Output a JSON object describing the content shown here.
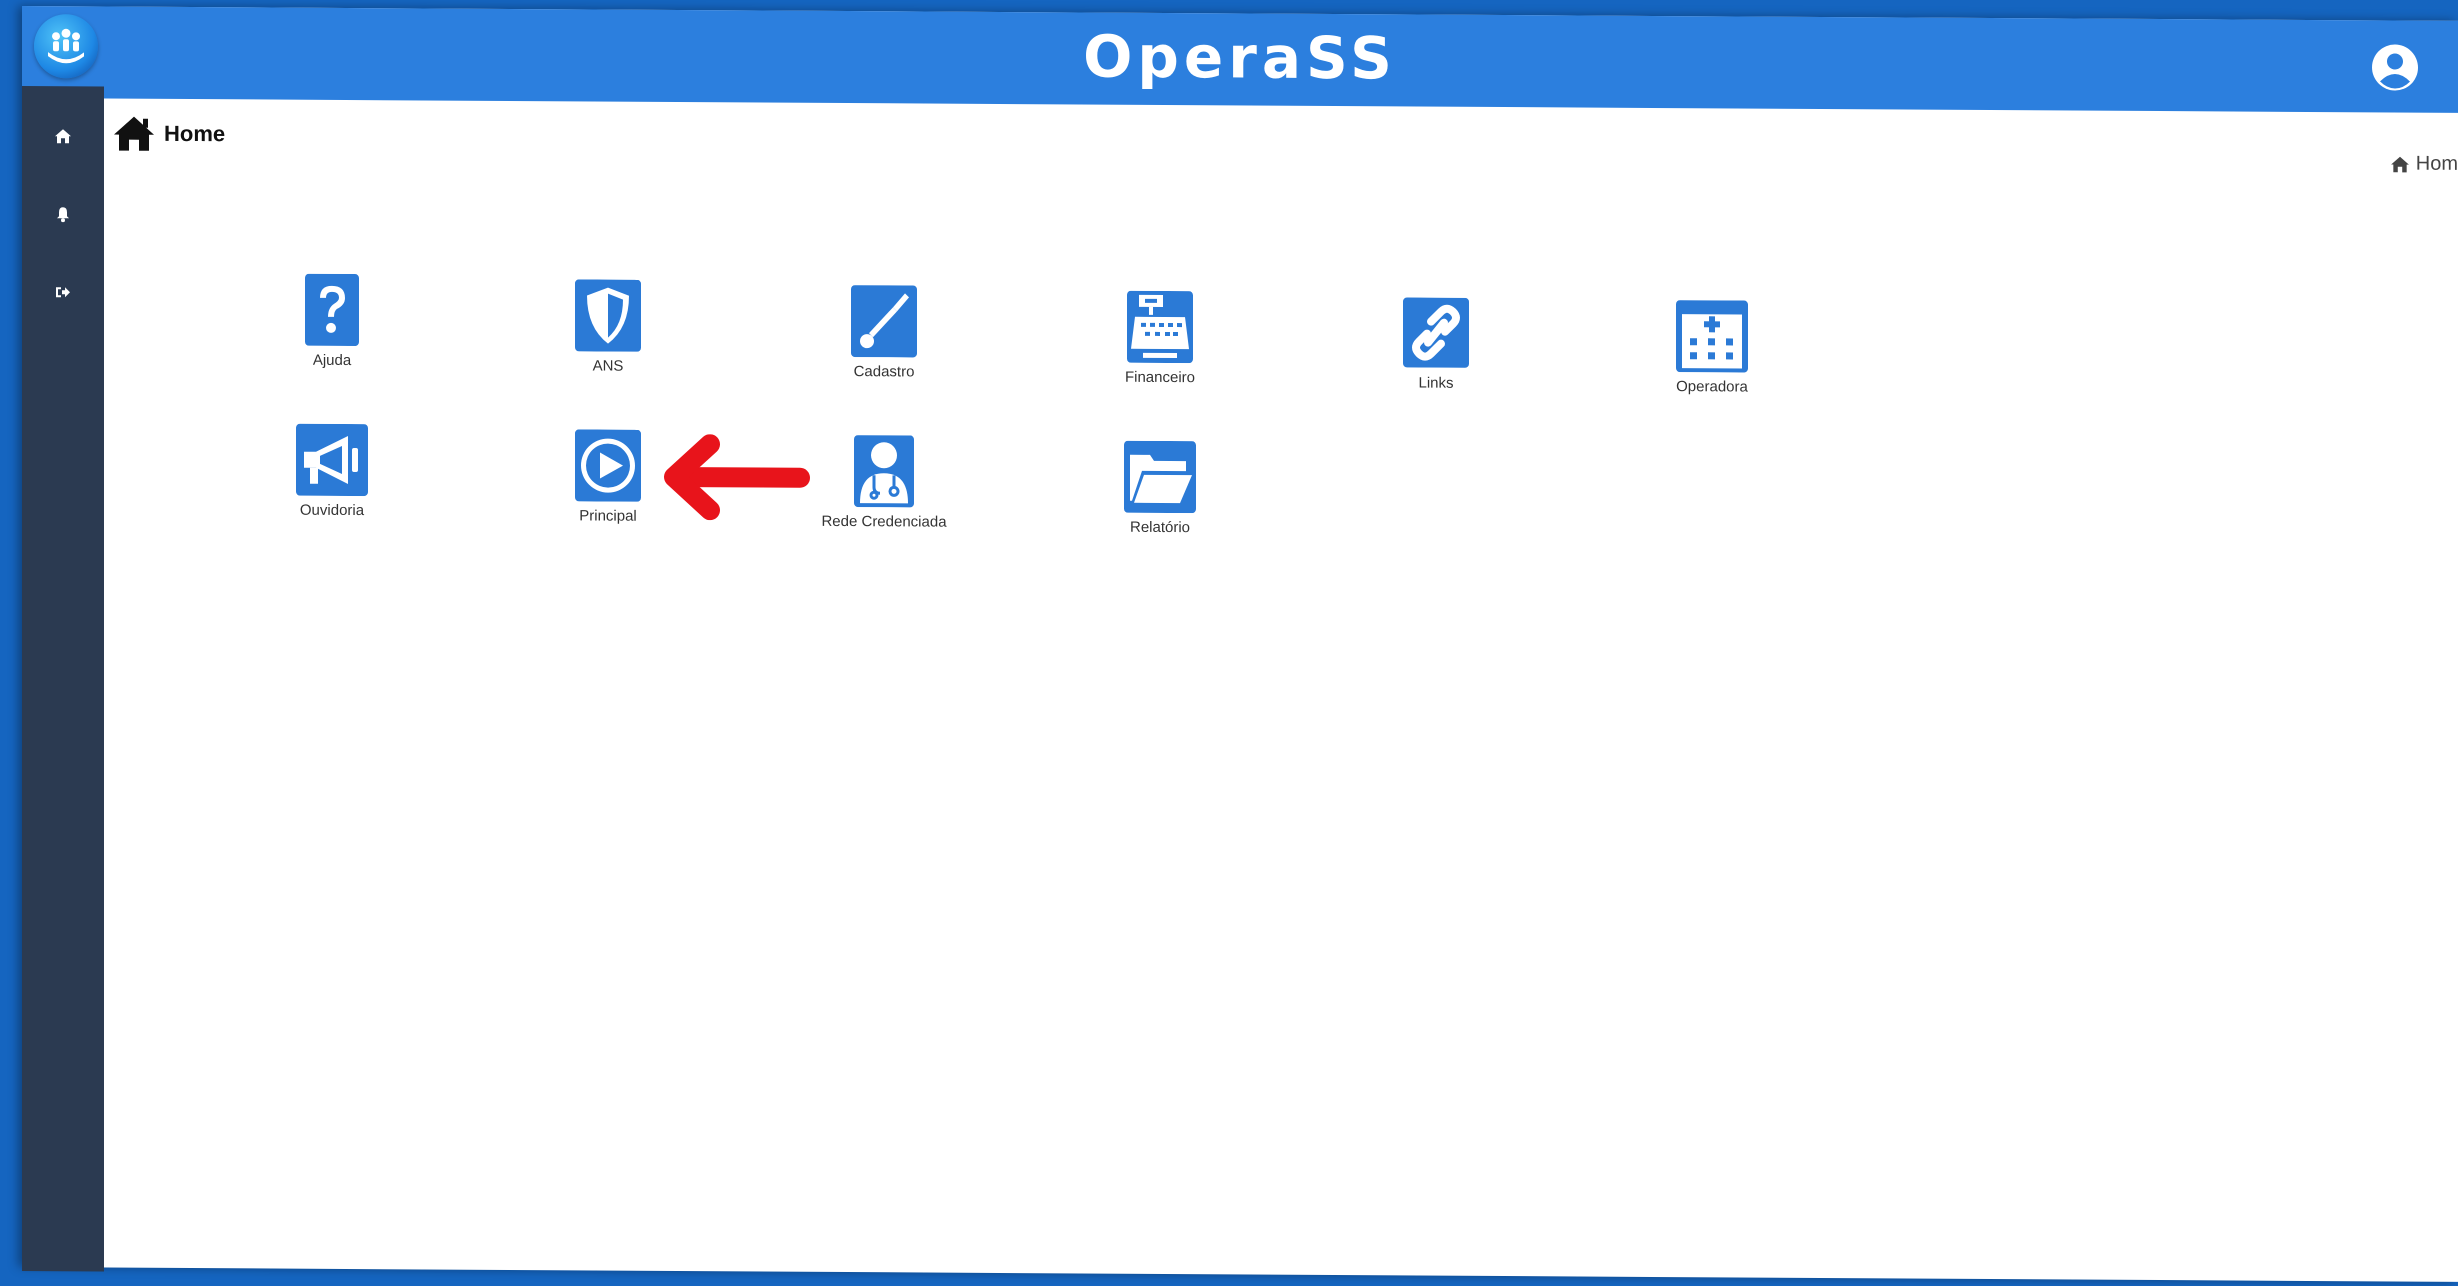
{
  "app": {
    "title": "OperaSS"
  },
  "header": {
    "logo_icon": "family-hands-logo-icon",
    "user_icon": "user-circle-icon"
  },
  "sidebar": {
    "items": [
      {
        "icon": "home-icon"
      },
      {
        "icon": "bell-icon"
      },
      {
        "icon": "sign-out-icon"
      }
    ]
  },
  "page": {
    "title": "Home",
    "breadcrumb": "Hom"
  },
  "tiles": [
    {
      "label": "Ajuda",
      "icon": "question-icon"
    },
    {
      "label": "ANS",
      "icon": "shield-icon"
    },
    {
      "label": "Cadastro",
      "icon": "screwdriver-wrench-icon"
    },
    {
      "label": "Financeiro",
      "icon": "cash-register-icon"
    },
    {
      "label": "Links",
      "icon": "link-icon"
    },
    {
      "label": "Operadora",
      "icon": "hospital-icon"
    },
    {
      "label": "Ouvidoria",
      "icon": "megaphone-icon"
    },
    {
      "label": "Principal",
      "icon": "play-circle-icon"
    },
    {
      "label": "Rede Credenciada",
      "icon": "doctor-icon"
    },
    {
      "label": "Relatório",
      "icon": "folder-open-icon"
    }
  ],
  "annotation": {
    "icon": "red-arrow-left-icon",
    "color": "#e8141b"
  },
  "colors": {
    "primary": "#2c7fde",
    "sidebar": "#2b3a51",
    "tile_icon": "#2b7ad6"
  }
}
